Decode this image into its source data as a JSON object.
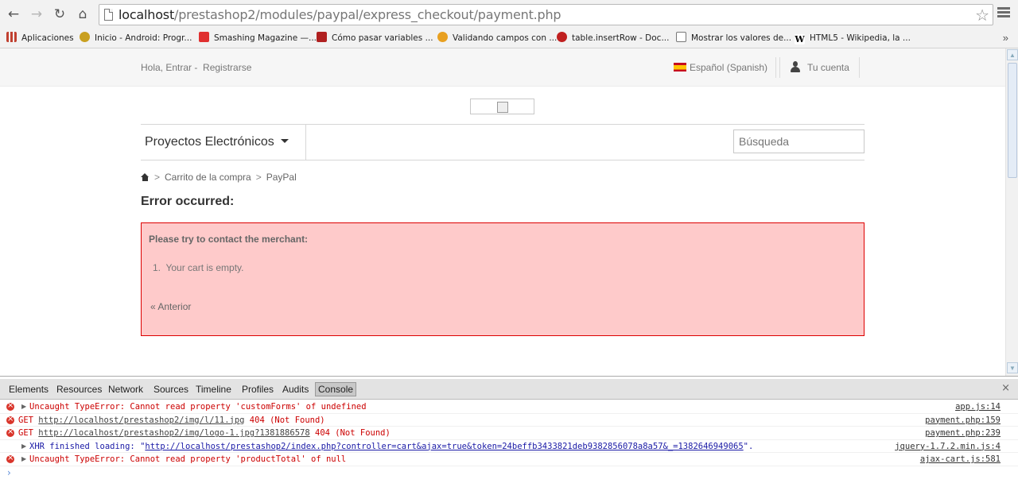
{
  "browser": {
    "url_host": "localhost",
    "url_path": "/prestashop2/modules/paypal/express_checkout/payment.php",
    "bookmarks": [
      {
        "label": "Aplicaciones",
        "color": "#c04030"
      },
      {
        "label": "Inicio - Android: Progr...",
        "color": "#c9a020"
      },
      {
        "label": "Smashing Magazine —...",
        "color": "#e03030"
      },
      {
        "label": "Cómo pasar variables ...",
        "color": "#b02020"
      },
      {
        "label": "Validando campos con ...",
        "color": "#e8a020"
      },
      {
        "label": "table.insertRow - Doc...",
        "color": "#c02020"
      },
      {
        "label": "Mostrar los valores de...",
        "color": "#ffffff"
      },
      {
        "label": "HTML5 - Wikipedia, la ...",
        "color": "#ffffff"
      }
    ],
    "bookmarks_more": "»"
  },
  "header": {
    "greeting": "Hola, Entrar",
    "greeting_sep": "-",
    "register": "Registrarse",
    "language": "Español (Spanish)",
    "account": "Tu cuenta"
  },
  "nav": {
    "category": "Proyectos Electrónicos",
    "search_placeholder": "Búsqueda"
  },
  "breadcrumb": {
    "sep": ">",
    "items": [
      "Carrito de la compra",
      "PayPal"
    ]
  },
  "content": {
    "error_title": "Error occurred:",
    "error_message_title": "Please try to contact the merchant:",
    "error_items": [
      "1.  Your cart is empty."
    ],
    "back_link": "« Anterior"
  },
  "devtools": {
    "tabs": [
      "Elements",
      "Resources",
      "Network",
      "Sources",
      "Timeline",
      "Profiles",
      "Audits",
      "Console"
    ],
    "active_tab": "Console",
    "close": "×",
    "lines": [
      {
        "type": "error",
        "expand": true,
        "text": "Uncaught TypeError: Cannot read property 'customForms' of undefined",
        "source": "app.js:14"
      },
      {
        "type": "error",
        "expand": false,
        "prefix": "GET ",
        "link": "http://localhost/prestashop2/img/l/11.jpg",
        "suffix": " 404 (Not Found)",
        "source": "payment.php:159"
      },
      {
        "type": "error",
        "expand": false,
        "prefix": "GET ",
        "link": "http://localhost/prestashop2/img/logo-1.jpg?1381886578",
        "suffix": " 404 (Not Found)",
        "source": "payment.php:239"
      },
      {
        "type": "info",
        "expand": true,
        "prefix": "XHR finished loading: \"",
        "link": "http://localhost/prestashop2/index.php?controller=cart&ajax=true&token=24beffb3433821deb9382856078a8a57&_=1382646949065",
        "suffix": "\".",
        "source": "jquery-1.7.2.min.js:4"
      },
      {
        "type": "error",
        "expand": true,
        "text": "Uncaught TypeError: Cannot read property 'productTotal' of null",
        "source": "ajax-cart.js:581"
      }
    ],
    "prompt": "›"
  }
}
